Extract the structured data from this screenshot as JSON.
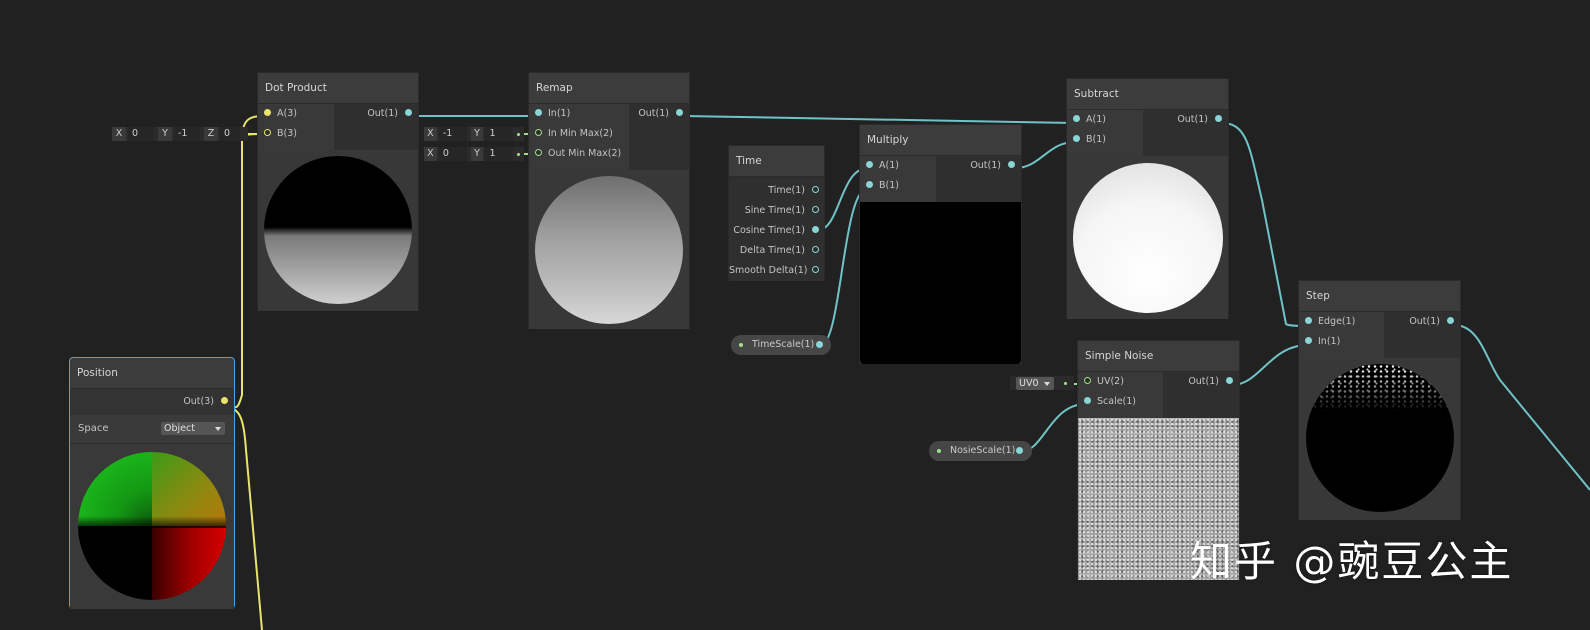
{
  "nodes": {
    "dot_product": {
      "title": "Dot Product",
      "inputs": [
        "A(3)",
        "B(3)"
      ],
      "output": "Out(1)"
    },
    "remap": {
      "title": "Remap",
      "inputs": [
        "In(1)",
        "In Min Max(2)",
        "Out Min Max(2)"
      ],
      "output": "Out(1)"
    },
    "time": {
      "title": "Time",
      "outputs": [
        "Time(1)",
        "Sine Time(1)",
        "Cosine Time(1)",
        "Delta Time(1)",
        "Smooth Delta(1)"
      ]
    },
    "multiply": {
      "title": "Multiply",
      "inputs": [
        "A(1)",
        "B(1)"
      ],
      "output": "Out(1)"
    },
    "subtract": {
      "title": "Subtract",
      "inputs": [
        "A(1)",
        "B(1)"
      ],
      "output": "Out(1)"
    },
    "simple_noise": {
      "title": "Simple Noise",
      "inputs": [
        "UV(2)",
        "Scale(1)"
      ],
      "output": "Out(1)"
    },
    "step": {
      "title": "Step",
      "inputs": [
        "Edge(1)",
        "In(1)"
      ],
      "output": "Out(1)"
    },
    "position": {
      "title": "Position",
      "output": "Out(3)",
      "space_label": "Space",
      "space_value": "Object"
    }
  },
  "fields": {
    "dot_b": {
      "x_label": "X",
      "x": "0",
      "y_label": "Y",
      "y": "-1",
      "z_label": "Z",
      "z": "0"
    },
    "remap_in_min_max": {
      "x_label": "X",
      "x": "-1",
      "y_label": "Y",
      "y": "1"
    },
    "remap_out_min_max": {
      "x_label": "X",
      "x": "0",
      "y_label": "Y",
      "y": "1"
    },
    "noise_uv": "UV0"
  },
  "properties": {
    "time_scale": "TimeScale(1)",
    "noise_scale": "NosieScale(1)"
  },
  "colors": {
    "canvas": "#212121",
    "node_body": "#383838",
    "wire_float": "#6fc3c7",
    "wire_vector3": "#e8e46b",
    "wire_vector2": "#9ee08a",
    "selected_border": "#44a6e6"
  },
  "watermark": "知乎 @豌豆公主"
}
